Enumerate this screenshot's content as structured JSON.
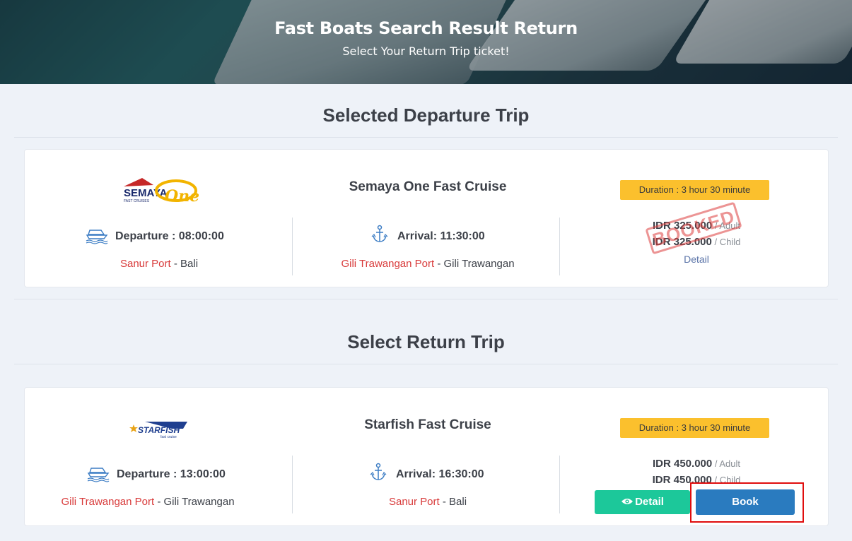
{
  "hero": {
    "title": "Fast Boats Search Result Return",
    "subtitle": "Select Your Return Trip ticket!"
  },
  "departure_section": {
    "title": "Selected Departure Trip",
    "trip": {
      "operator": "Semaya One Fast Cruise",
      "logo_text_main": "SEMAYA",
      "logo_text_script": "One",
      "logo_text_small": "FAST CRUISES",
      "duration": "Duration : 3 hour 30 minute",
      "departure": "Departure : 08:00:00",
      "departure_port": "Sanur Port",
      "departure_region": " - Bali",
      "arrival": "Arrival: 11:30:00",
      "arrival_port": "Gili Trawangan Port",
      "arrival_region": " - Gili Trawangan",
      "price_adult": "IDR 325.000",
      "price_adult_unit": " / Adult",
      "price_child": "IDR 325.000",
      "price_child_unit": " / Child",
      "detail_link": "Detail",
      "stamp": "BOOKED"
    }
  },
  "return_section": {
    "title": "Select Return Trip",
    "trip": {
      "operator": "Starfish Fast Cruise",
      "logo_text": "STARFISH",
      "logo_text_small": "fast cruise",
      "duration": "Duration : 3 hour 30 minute",
      "departure": "Departure : 13:00:00",
      "departure_port": "Gili Trawangan Port",
      "departure_region": " - Gili Trawangan",
      "arrival": "Arrival: 16:30:00",
      "arrival_port": "Sanur Port",
      "arrival_region": " - Bali",
      "price_adult": "IDR 450.000",
      "price_adult_unit": " / Adult",
      "price_child": "IDR 450.000",
      "price_child_unit": " / Child",
      "detail_button": "Detail",
      "book_button": "Book"
    }
  },
  "colors": {
    "accent_red": "#d83a3a",
    "duration_badge": "#fbc02d",
    "detail_button": "#1cc89a",
    "book_button": "#2a7bbf",
    "highlight": "#e00d0d"
  }
}
